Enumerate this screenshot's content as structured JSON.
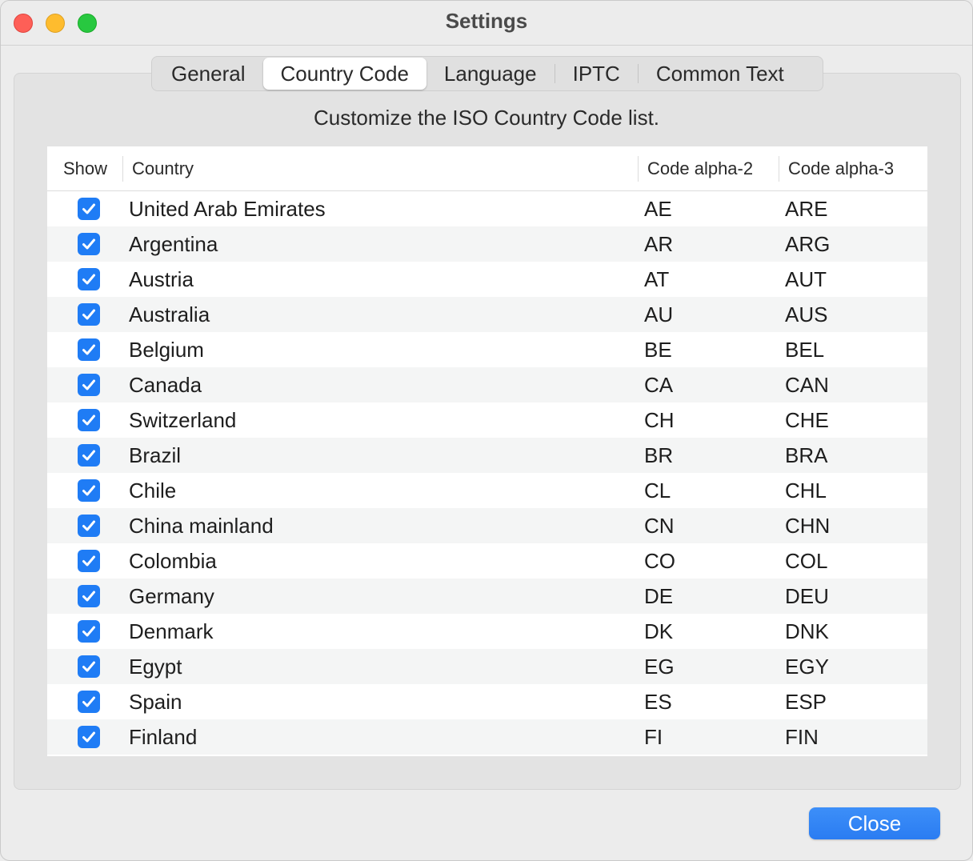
{
  "window": {
    "title": "Settings"
  },
  "tabs": [
    {
      "label": "General",
      "active": false
    },
    {
      "label": "Country Code",
      "active": true
    },
    {
      "label": "Language",
      "active": false
    },
    {
      "label": "IPTC",
      "active": false
    },
    {
      "label": "Common Text",
      "active": false
    }
  ],
  "subtitle": "Customize the ISO Country Code list.",
  "table": {
    "headers": {
      "show": "Show",
      "country": "Country",
      "alpha2": "Code alpha-2",
      "alpha3": "Code alpha-3"
    },
    "rows": [
      {
        "checked": true,
        "country": "United Arab Emirates",
        "alpha2": "AE",
        "alpha3": "ARE"
      },
      {
        "checked": true,
        "country": "Argentina",
        "alpha2": "AR",
        "alpha3": "ARG"
      },
      {
        "checked": true,
        "country": "Austria",
        "alpha2": "AT",
        "alpha3": "AUT"
      },
      {
        "checked": true,
        "country": "Australia",
        "alpha2": "AU",
        "alpha3": "AUS"
      },
      {
        "checked": true,
        "country": "Belgium",
        "alpha2": "BE",
        "alpha3": "BEL"
      },
      {
        "checked": true,
        "country": "Canada",
        "alpha2": "CA",
        "alpha3": "CAN"
      },
      {
        "checked": true,
        "country": "Switzerland",
        "alpha2": "CH",
        "alpha3": "CHE"
      },
      {
        "checked": true,
        "country": "Brazil",
        "alpha2": "BR",
        "alpha3": "BRA"
      },
      {
        "checked": true,
        "country": "Chile",
        "alpha2": "CL",
        "alpha3": "CHL"
      },
      {
        "checked": true,
        "country": "China mainland",
        "alpha2": "CN",
        "alpha3": "CHN"
      },
      {
        "checked": true,
        "country": "Colombia",
        "alpha2": "CO",
        "alpha3": "COL"
      },
      {
        "checked": true,
        "country": "Germany",
        "alpha2": "DE",
        "alpha3": "DEU"
      },
      {
        "checked": true,
        "country": "Denmark",
        "alpha2": "DK",
        "alpha3": "DNK"
      },
      {
        "checked": true,
        "country": "Egypt",
        "alpha2": "EG",
        "alpha3": "EGY"
      },
      {
        "checked": true,
        "country": "Spain",
        "alpha2": "ES",
        "alpha3": "ESP"
      },
      {
        "checked": true,
        "country": "Finland",
        "alpha2": "FI",
        "alpha3": "FIN"
      }
    ]
  },
  "close_label": "Close",
  "colors": {
    "accent": "#1f7cf5",
    "close_traffic": "#fe5f57",
    "minimize_traffic": "#febc2e",
    "zoom_traffic": "#28c840"
  }
}
